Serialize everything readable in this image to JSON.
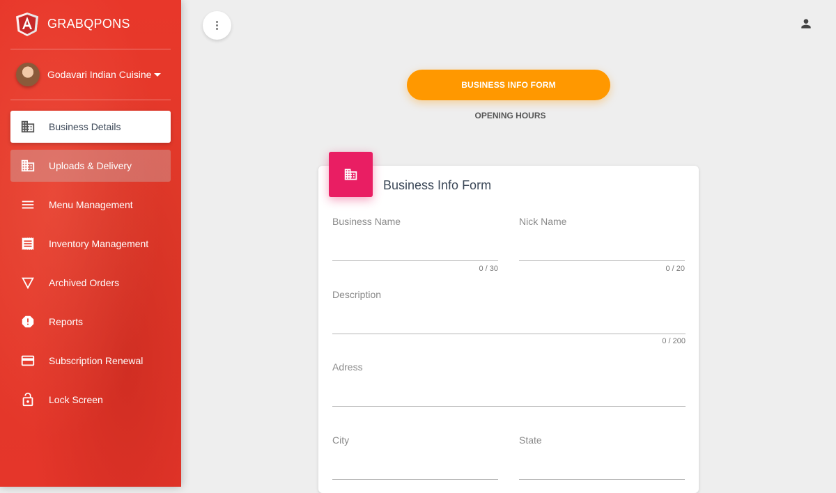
{
  "brand": {
    "name": "GRABQPONS",
    "logo_icon": "angular-logo-icon"
  },
  "user": {
    "name": "Godavari Indian Cuisine"
  },
  "colors": {
    "sidebar": "#e53a2a",
    "accent_orange": "#ff9800",
    "card_icon": "#e91e63"
  },
  "sidebar": {
    "items": [
      {
        "label": "Business Details",
        "icon": "building-icon",
        "state": "active"
      },
      {
        "label": "Uploads & Delivery",
        "icon": "building-icon",
        "state": "hover"
      },
      {
        "label": "Menu Management",
        "icon": "menu-lines-icon",
        "state": "normal"
      },
      {
        "label": "Inventory Management",
        "icon": "receipt-icon",
        "state": "normal"
      },
      {
        "label": "Archived Orders",
        "icon": "triangle-down-icon",
        "state": "normal"
      },
      {
        "label": "Reports",
        "icon": "alert-icon",
        "state": "normal"
      },
      {
        "label": "Subscription Renewal",
        "icon": "credit-card-icon",
        "state": "normal"
      },
      {
        "label": "Lock Screen",
        "icon": "lock-icon",
        "state": "normal"
      }
    ]
  },
  "tabs": [
    {
      "label": "BUSINESS INFO FORM",
      "active": true
    },
    {
      "label": "OPENING HOURS",
      "active": false
    }
  ],
  "form": {
    "title": "Business Info Form",
    "fields": {
      "business_name": {
        "label": "Business Name",
        "value": "",
        "counter": "0 / 30"
      },
      "nick_name": {
        "label": "Nick Name",
        "value": "",
        "counter": "0 / 20"
      },
      "description": {
        "label": "Description",
        "value": "",
        "counter": "0 / 200"
      },
      "address": {
        "label": "Adress",
        "value": ""
      },
      "city": {
        "label": "City",
        "value": ""
      },
      "state": {
        "label": "State",
        "value": ""
      }
    }
  }
}
